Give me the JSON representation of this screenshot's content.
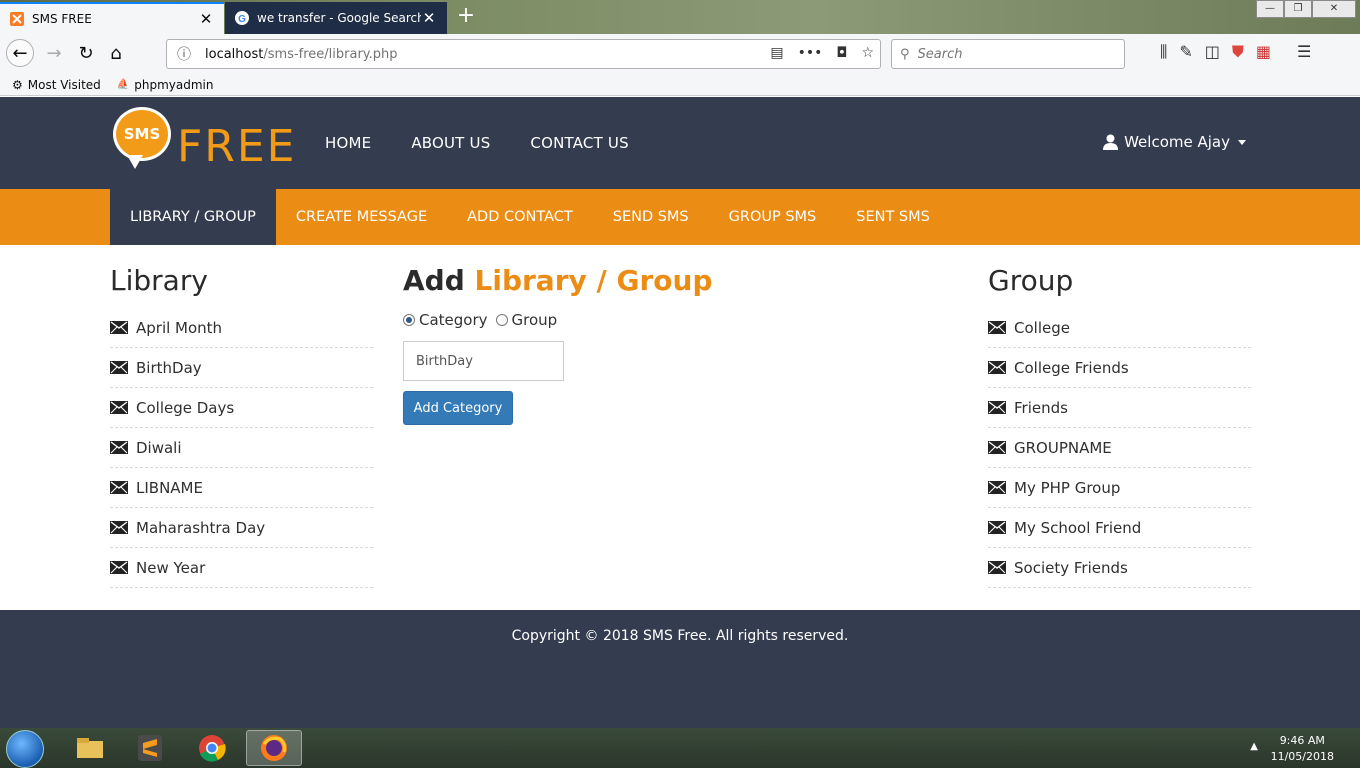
{
  "browser": {
    "tabs": [
      {
        "title": "SMS FREE",
        "active": true
      },
      {
        "title": "we transfer - Google Search",
        "active": false
      }
    ],
    "url_host": "localhost",
    "url_path": "/sms-free/library.php",
    "search_placeholder": "Search",
    "bookmarks": [
      "Most Visited",
      "phpmyadmin"
    ]
  },
  "site": {
    "logo_bubble": "SMS",
    "logo_text": "FREE",
    "nav": [
      "HOME",
      "ABOUT US",
      "CONTACT US"
    ],
    "welcome": "Welcome Ajay",
    "subnav": [
      "LIBRARY / GROUP",
      "CREATE MESSAGE",
      "ADD CONTACT",
      "SEND SMS",
      "GROUP SMS",
      "SENT SMS"
    ],
    "subnav_active": 0
  },
  "library": {
    "title": "Library",
    "items": [
      "April Month",
      "BirthDay",
      "College Days",
      "Diwali",
      "LIBNAME",
      "Maharashtra Day",
      "New Year"
    ]
  },
  "add_form": {
    "title_prefix": "Add",
    "title_accent": "Library / Group",
    "radio_category": "Category",
    "radio_group": "Group",
    "selected": "Category",
    "input_value": "BirthDay",
    "button_label": "Add Category"
  },
  "group": {
    "title": "Group",
    "items": [
      "College",
      "College Friends",
      "Friends",
      "GROUPNAME",
      "My PHP Group",
      "My School Friend",
      "Society Friends"
    ]
  },
  "footer": {
    "copyright": "Copyright © 2018 SMS Free. All rights reserved."
  },
  "taskbar": {
    "time": "9:46 AM",
    "date": "11/05/2018"
  },
  "colors": {
    "header_bg": "#343d4f",
    "accent_orange": "#eb8c14",
    "button_blue": "#337ab7"
  }
}
